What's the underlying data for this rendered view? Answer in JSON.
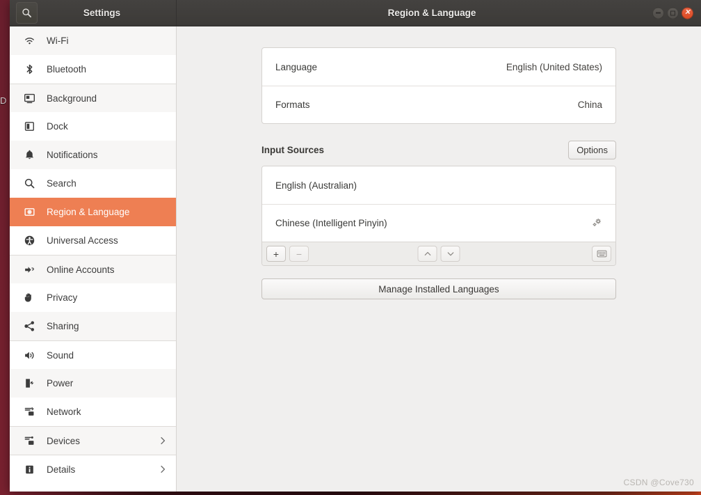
{
  "desktop": {
    "edge_glyph": "D"
  },
  "titlebar": {
    "search_icon": "search-icon",
    "sidebar_title": "Settings",
    "window_title": "Region & Language",
    "buttons": {
      "minimize": "minimize",
      "maximize": "maximize",
      "close": "close"
    }
  },
  "sidebar": {
    "items": [
      {
        "label": "Wi-Fi",
        "icon": "wifi-icon",
        "selected": false,
        "chevron": false,
        "alt": true,
        "sep": false
      },
      {
        "label": "Bluetooth",
        "icon": "bluetooth-icon",
        "selected": false,
        "chevron": false,
        "alt": false,
        "sep": false
      },
      {
        "label": "Background",
        "icon": "background-icon",
        "selected": false,
        "chevron": false,
        "alt": true,
        "sep": true
      },
      {
        "label": "Dock",
        "icon": "dock-icon",
        "selected": false,
        "chevron": false,
        "alt": false,
        "sep": false
      },
      {
        "label": "Notifications",
        "icon": "bell-icon",
        "selected": false,
        "chevron": false,
        "alt": true,
        "sep": false
      },
      {
        "label": "Search",
        "icon": "search-icon",
        "selected": false,
        "chevron": false,
        "alt": false,
        "sep": false
      },
      {
        "label": "Region & Language",
        "icon": "region-language-icon",
        "selected": true,
        "chevron": false,
        "alt": false,
        "sep": false
      },
      {
        "label": "Universal Access",
        "icon": "accessibility-icon",
        "selected": false,
        "chevron": false,
        "alt": false,
        "sep": false
      },
      {
        "label": "Online Accounts",
        "icon": "online-accounts-icon",
        "selected": false,
        "chevron": false,
        "alt": true,
        "sep": true
      },
      {
        "label": "Privacy",
        "icon": "hand-icon",
        "selected": false,
        "chevron": false,
        "alt": false,
        "sep": false
      },
      {
        "label": "Sharing",
        "icon": "share-icon",
        "selected": false,
        "chevron": false,
        "alt": true,
        "sep": false
      },
      {
        "label": "Sound",
        "icon": "speaker-icon",
        "selected": false,
        "chevron": false,
        "alt": false,
        "sep": true
      },
      {
        "label": "Power",
        "icon": "power-icon",
        "selected": false,
        "chevron": false,
        "alt": true,
        "sep": false
      },
      {
        "label": "Network",
        "icon": "network-icon",
        "selected": false,
        "chevron": false,
        "alt": false,
        "sep": false
      },
      {
        "label": "Devices",
        "icon": "devices-icon",
        "selected": false,
        "chevron": true,
        "alt": true,
        "sep": true
      },
      {
        "label": "Details",
        "icon": "info-icon",
        "selected": false,
        "chevron": true,
        "alt": false,
        "sep": true
      }
    ]
  },
  "main": {
    "language_card": [
      {
        "key": "Language",
        "value": "English (United States)"
      },
      {
        "key": "Formats",
        "value": "China"
      }
    ],
    "input_sources": {
      "title": "Input Sources",
      "options_label": "Options",
      "sources": [
        {
          "name": "English (Australian)",
          "has_settings": false
        },
        {
          "name": "Chinese (Intelligent Pinyin)",
          "has_settings": true
        }
      ],
      "toolbar": {
        "add": "+",
        "remove": "−",
        "move_up": "move-up",
        "move_down": "move-down",
        "keyboard": "keyboard-layout"
      }
    },
    "manage_languages_label": "Manage Installed Languages"
  },
  "watermark": "CSDN @Cove730",
  "colors": {
    "accent": "#ee7f53",
    "titlebar": "#3c3a37",
    "content_bg": "#f0efee",
    "close_button": "#e0532a"
  }
}
